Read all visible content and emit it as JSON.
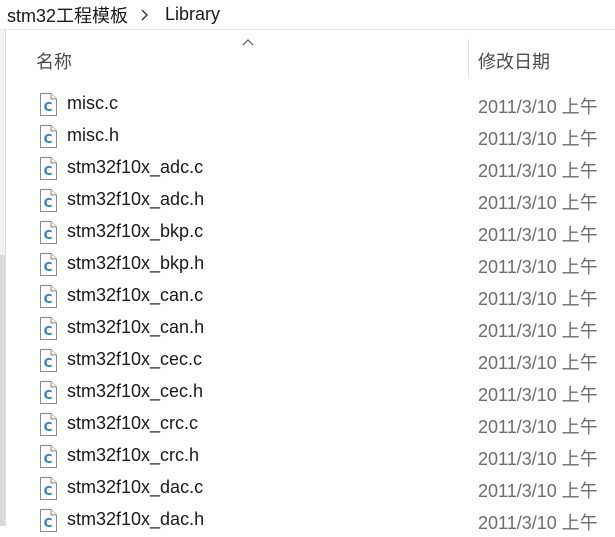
{
  "breadcrumb": {
    "items": [
      "stm32工程模板",
      "Library"
    ]
  },
  "header": {
    "name_label": "名称",
    "date_label": "修改日期",
    "sort_indicator": "ascending"
  },
  "icons": {
    "file_icon": "c-source-file-icon",
    "separator": "chevron-right-icon",
    "sort": "sort-up-icon"
  },
  "colors": {
    "icon_blue": "#2e7dbf",
    "date_text": "#6d6d6d"
  },
  "files": [
    {
      "name": "misc.c",
      "date": "2011/3/10 上午"
    },
    {
      "name": "misc.h",
      "date": "2011/3/10 上午"
    },
    {
      "name": "stm32f10x_adc.c",
      "date": "2011/3/10 上午"
    },
    {
      "name": "stm32f10x_adc.h",
      "date": "2011/3/10 上午"
    },
    {
      "name": "stm32f10x_bkp.c",
      "date": "2011/3/10 上午"
    },
    {
      "name": "stm32f10x_bkp.h",
      "date": "2011/3/10 上午"
    },
    {
      "name": "stm32f10x_can.c",
      "date": "2011/3/10 上午"
    },
    {
      "name": "stm32f10x_can.h",
      "date": "2011/3/10 上午"
    },
    {
      "name": "stm32f10x_cec.c",
      "date": "2011/3/10 上午"
    },
    {
      "name": "stm32f10x_cec.h",
      "date": "2011/3/10 上午"
    },
    {
      "name": "stm32f10x_crc.c",
      "date": "2011/3/10 上午"
    },
    {
      "name": "stm32f10x_crc.h",
      "date": "2011/3/10 上午"
    },
    {
      "name": "stm32f10x_dac.c",
      "date": "2011/3/10 上午"
    },
    {
      "name": "stm32f10x_dac.h",
      "date": "2011/3/10 上午"
    }
  ]
}
